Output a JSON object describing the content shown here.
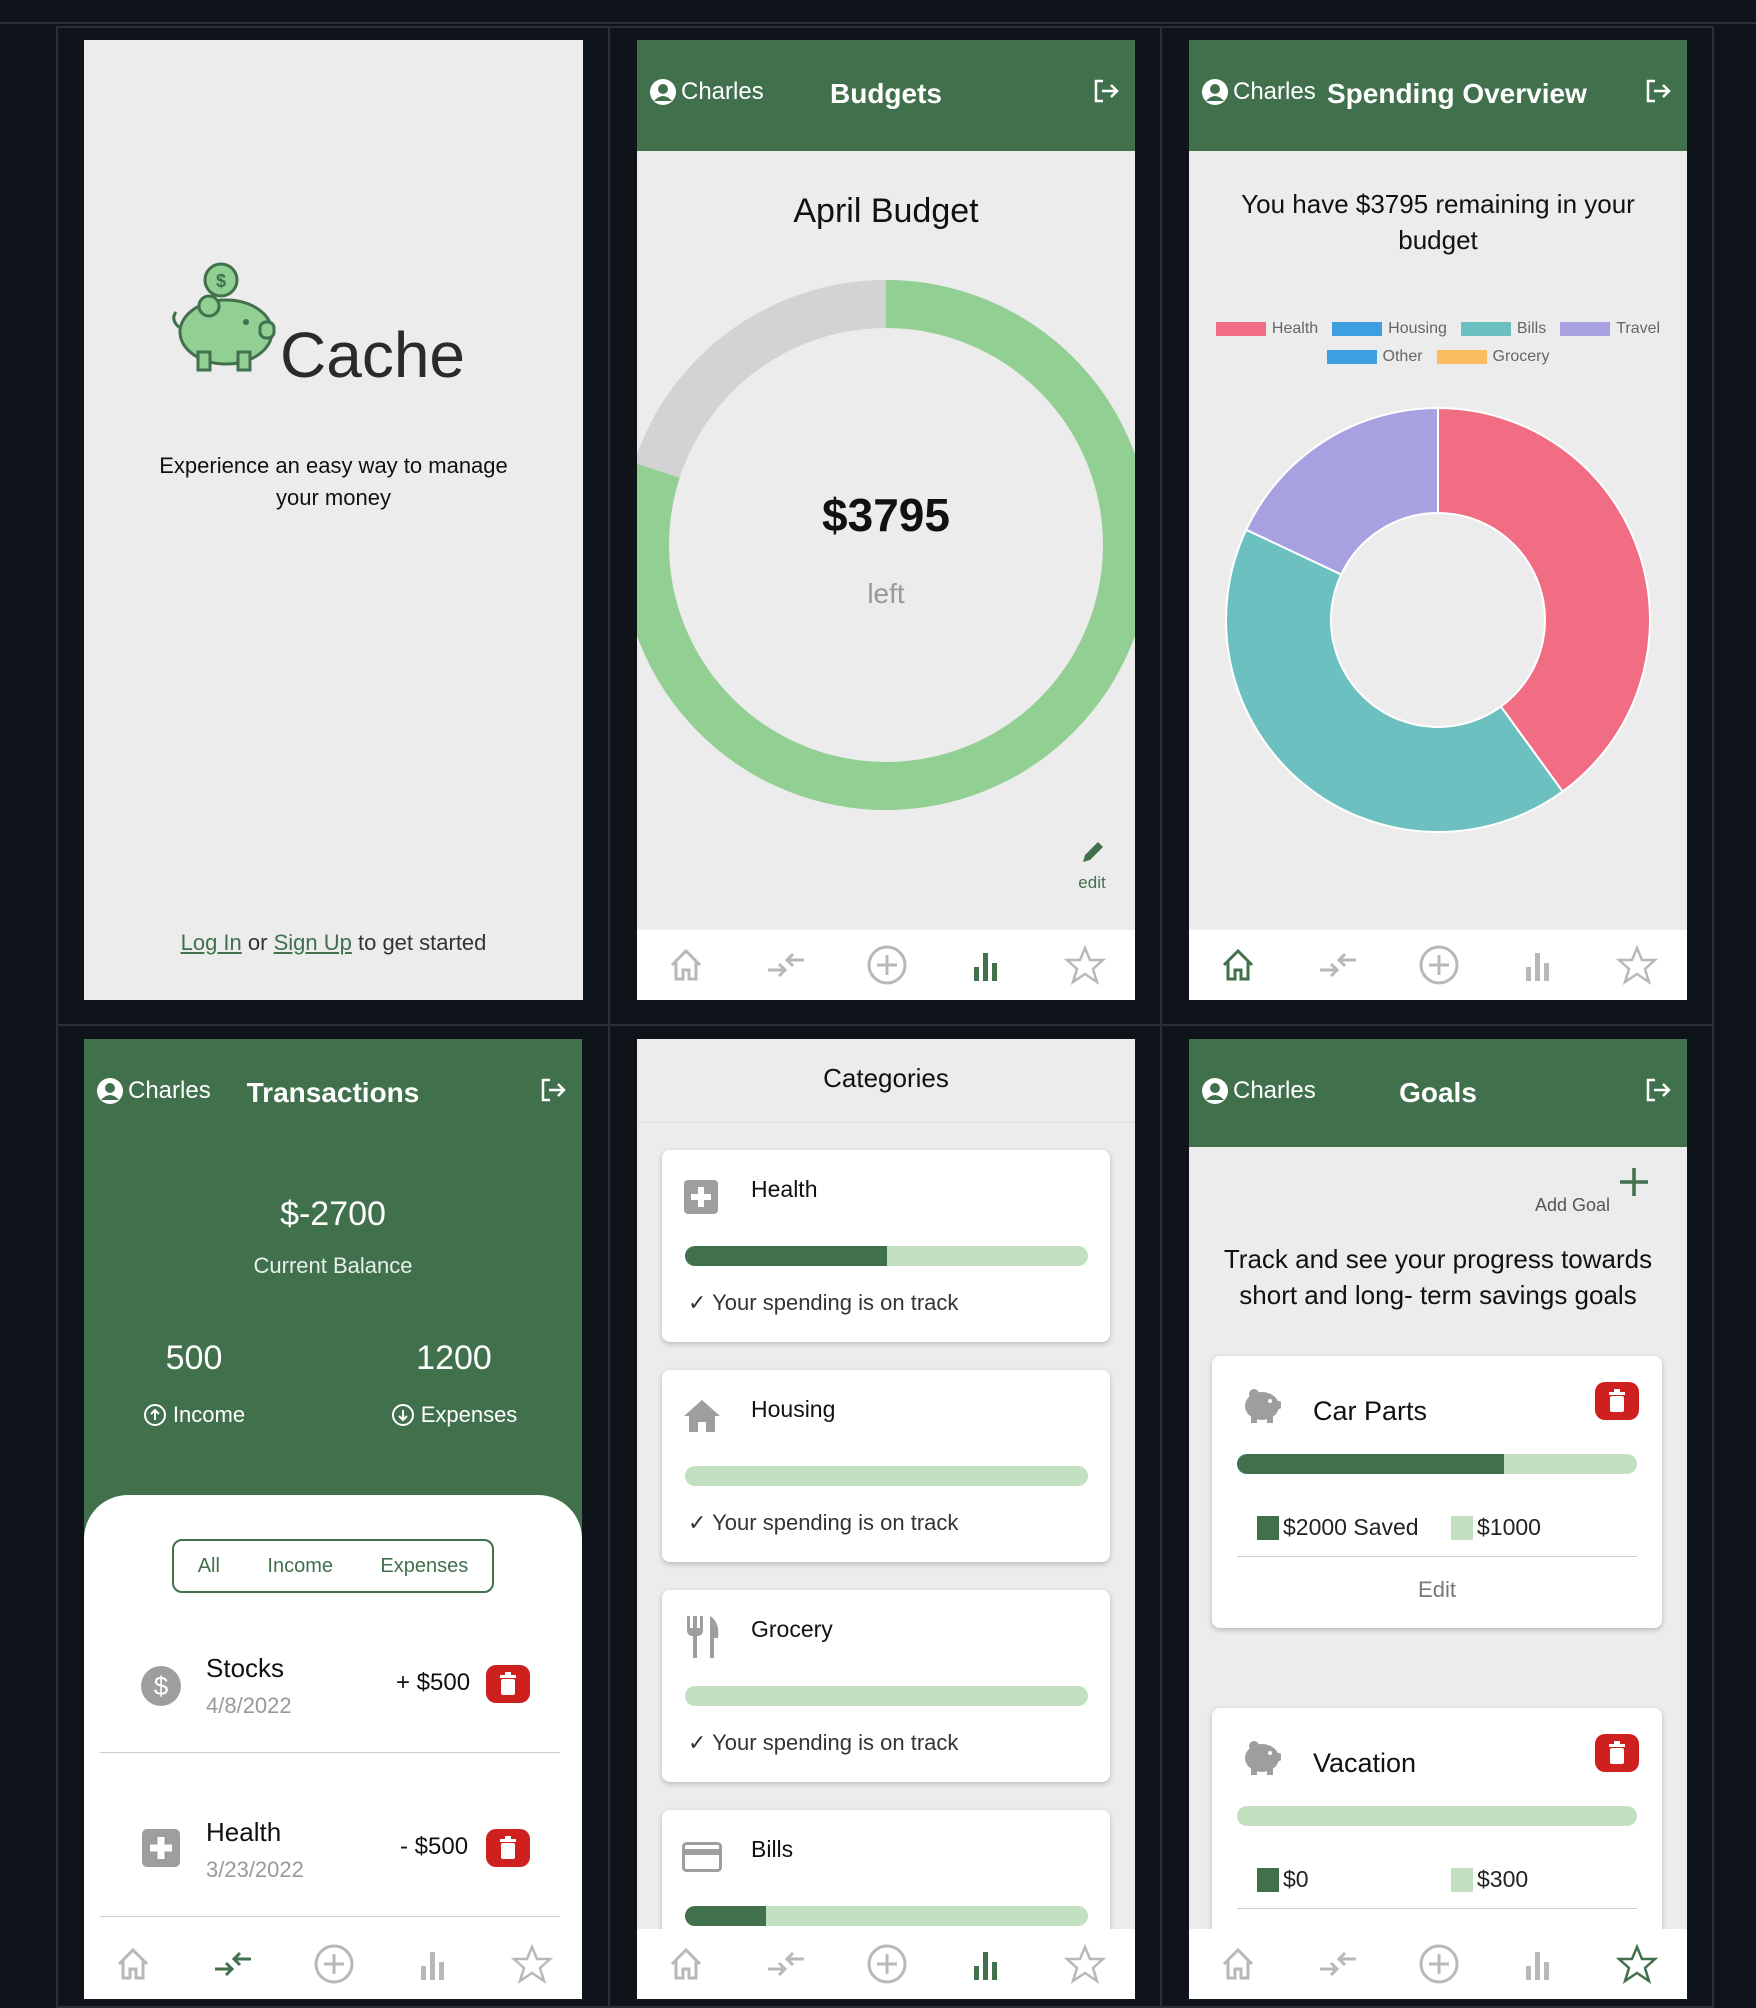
{
  "colors": {
    "brand_green": "#41704d",
    "light_green": "#92cf92",
    "bar_track": "#c2e0c0",
    "danger": "#cf2020"
  },
  "user_name": "Charles",
  "landing": {
    "app_name": "Cache",
    "tagline_line1": "Experience an easy way to manage",
    "tagline_line2": "your money",
    "login_link": "Log In",
    "or_text": "or",
    "signup_link": "Sign Up",
    "suffix": "to get started"
  },
  "budgets": {
    "title": "Budgets",
    "heading": "April Budget",
    "amount_left": "$3795",
    "left_label": "left",
    "edit_label": "edit",
    "remaining_fraction": 0.8
  },
  "overview": {
    "title": "Spending Overview",
    "message_line1": "You have $3795 remaining in your",
    "message_line2": "budget",
    "chart_data": {
      "type": "pie",
      "categories": [
        "Health",
        "Housing",
        "Bills",
        "Travel",
        "Other",
        "Grocery"
      ],
      "values": [
        40,
        0,
        42,
        18,
        0,
        0
      ],
      "colors": [
        "#f06d84",
        "#3e9fe0",
        "#6cc0c0",
        "#a7a0e1",
        "#3e9fe0",
        "#f9bd5f"
      ],
      "legend_position": "top"
    }
  },
  "transactions": {
    "title": "Transactions",
    "balance": "$-2700",
    "balance_label": "Current Balance",
    "income_value": "500",
    "income_label": "Income",
    "expenses_value": "1200",
    "expenses_label": "Expenses",
    "filters": [
      "All",
      "Income",
      "Expenses"
    ],
    "items": [
      {
        "name": "Stocks",
        "date": "4/8/2022",
        "amount": "+ $500",
        "icon": "dollar-icon"
      },
      {
        "name": "Health",
        "date": "3/23/2022",
        "amount": "- $500",
        "icon": "medical-cross-icon"
      }
    ]
  },
  "categories": {
    "title": "Categories",
    "items": [
      {
        "name": "Health",
        "status": "Your spending is on track",
        "progress": 0.5,
        "icon": "medical-cross-icon"
      },
      {
        "name": "Housing",
        "status": "Your spending is on track",
        "progress": 0,
        "icon": "house-icon"
      },
      {
        "name": "Grocery",
        "status": "Your spending is on track",
        "progress": 0,
        "icon": "fork-knife-icon"
      },
      {
        "name": "Bills",
        "status": "",
        "progress": 0.2,
        "icon": "credit-card-icon"
      }
    ]
  },
  "goals": {
    "title": "Goals",
    "add_label": "Add Goal",
    "intro_line1": "Track and see your progress towards",
    "intro_line2": "short and long- term savings goals",
    "items": [
      {
        "name": "Car Parts",
        "saved": "$2000 Saved",
        "remaining": "$1000",
        "progress": 0.667,
        "edit_label": "Edit"
      },
      {
        "name": "Vacation",
        "saved": "$0",
        "remaining": "$300",
        "progress": 0
      }
    ]
  }
}
